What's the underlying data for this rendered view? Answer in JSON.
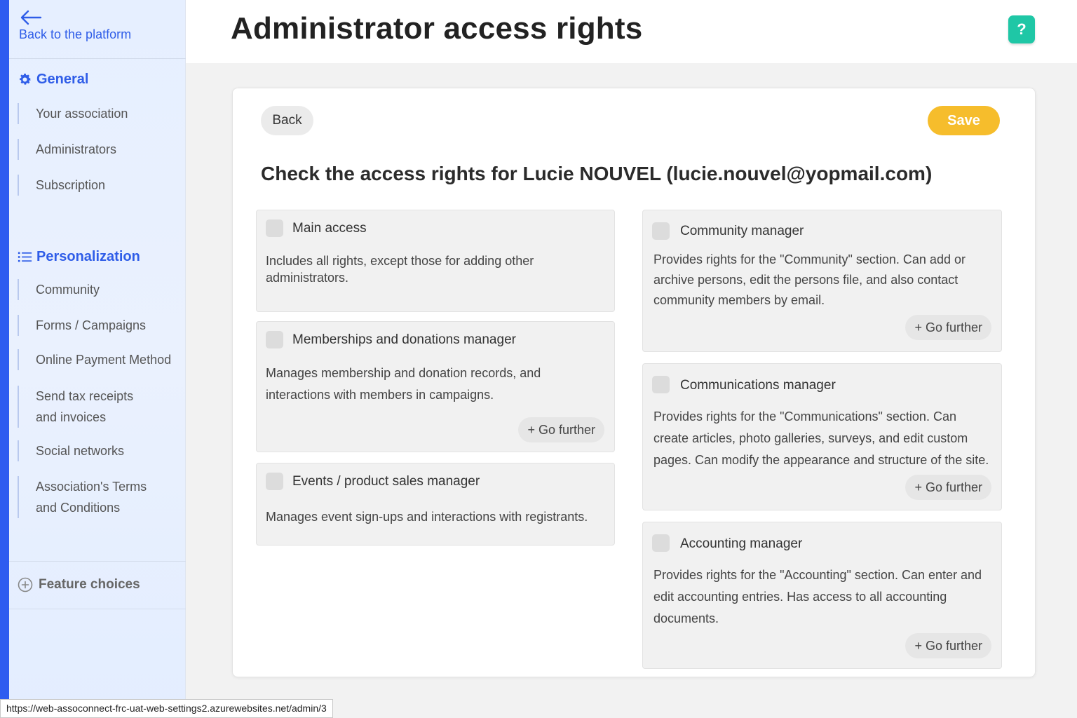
{
  "sidebar": {
    "back_label": "Back to the platform",
    "general": {
      "title": "General",
      "items": [
        {
          "label": "Your association"
        },
        {
          "label": "Administrators"
        },
        {
          "label": "Subscription"
        }
      ]
    },
    "personalization": {
      "title": "Personalization",
      "items": [
        {
          "label": "Community"
        },
        {
          "label": "Forms / Campaigns"
        },
        {
          "label": "Online Payment Method"
        },
        {
          "label": "Send tax receipts and invoices"
        },
        {
          "label": "Social networks"
        },
        {
          "label": "Association's Terms and Conditions"
        }
      ]
    },
    "feature_choices": "Feature choices"
  },
  "header": {
    "title": "Administrator access rights",
    "help_label": "?"
  },
  "main": {
    "back_label": "Back",
    "save_label": "Save",
    "heading": "Check the access rights for Lucie NOUVEL (lucie.nouvel@yopmail.com)",
    "go_further_label": "+ Go further",
    "roles": {
      "main_access": {
        "title": "Main access",
        "description": "Includes all rights, except those for adding other administrators.",
        "checked": false
      },
      "memberships": {
        "title": "Memberships and donations manager",
        "description": "Manages membership and donation records, and interactions with members in campaigns.",
        "checked": false
      },
      "events": {
        "title": "Events / product sales manager",
        "description": "Manages event sign-ups and interactions with registrants.",
        "checked": false
      },
      "community": {
        "title": "Community manager",
        "description": "Provides rights for the \"Community\" section. Can add or archive persons, edit the persons file, and also contact community members by email.",
        "checked": false
      },
      "communications": {
        "title": "Communications manager",
        "description": "Provides rights for the \"Communications\" section. Can create articles, photo galleries, surveys, and edit custom pages. Can modify the appearance and structure of the site.",
        "checked": false
      },
      "accounting": {
        "title": "Accounting manager",
        "description": "Provides rights for the \"Accounting\" section. Can enter and edit accounting entries. Has access to all accounting documents.",
        "checked": false
      }
    }
  },
  "status_bar": {
    "url": "https://web-assoconnect-frc-uat-web-settings2.azurewebsites.net/admin/3"
  },
  "colors": {
    "accent_blue": "#2e5cf0",
    "save_yellow": "#f6bd2c",
    "help_teal": "#1fc7a6"
  },
  "icons": {
    "back": "arrow-left-icon",
    "general": "gear-icon",
    "personalization": "list-icon",
    "feature_choices": "plus-circle-icon",
    "help": "question-icon"
  }
}
